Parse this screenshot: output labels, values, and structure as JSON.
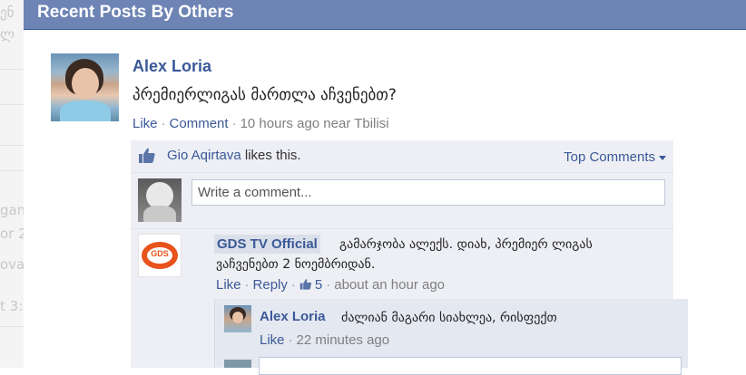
{
  "background_fragments": [
    "ენ",
    "ლ",
    "gam",
    "or 2",
    "ova",
    "t 3:"
  ],
  "dialog": {
    "title": "Recent Posts By Others"
  },
  "post": {
    "author": "Alex Loria",
    "text": "პრემიერლიგას მართლა აჩვენებთ?",
    "like_label": "Like",
    "comment_label": "Comment",
    "time": "10 hours ago near Tbilisi"
  },
  "likes": {
    "liker": "Gio Aqirtava",
    "suffix": "likes this.",
    "top_comments_label": "Top Comments"
  },
  "write_comment": {
    "placeholder": "Write a comment..."
  },
  "comment": {
    "author": "GDS TV Official",
    "text_line1": "გამარჯობა ალექს. დიახ, პრემიერ ლიგას",
    "text_line2": "ვაჩვენებთ 2 ნოემბრიდან.",
    "like_label": "Like",
    "reply_label": "Reply",
    "like_count": "5",
    "time": "about an hour ago",
    "avatar_text": "GDS"
  },
  "reply": {
    "author": "Alex Loria",
    "text": "ძალიან მაგარი სიახლეა, რისფექთ",
    "like_label": "Like",
    "time": "22 minutes ago"
  },
  "colors": {
    "header": "#6d84b4",
    "link": "#3b5998",
    "ufi_bg": "#edeff4"
  }
}
